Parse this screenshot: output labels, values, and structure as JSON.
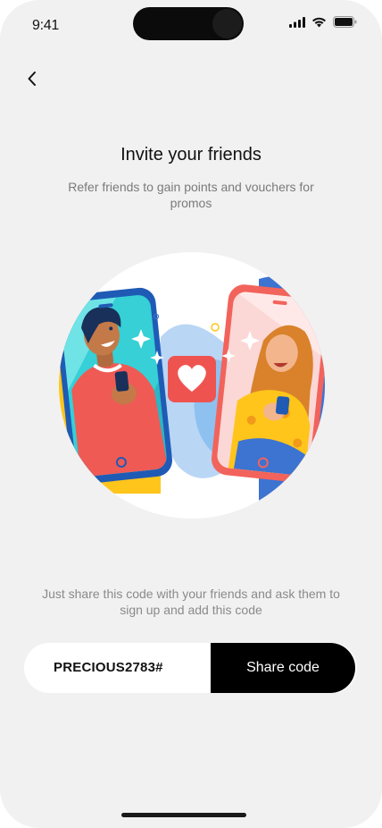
{
  "status_bar": {
    "time": "9:41"
  },
  "header": {
    "back_icon": "chevron-left-icon"
  },
  "main": {
    "title": "Invite your friends",
    "subtitle": "Refer friends to gain points and vouchers for promos",
    "illustration": "two-friends-phones-heart-illustration",
    "hint": "Just share this code with your friends and ask them to sign up and add this code"
  },
  "referral": {
    "code": "PRECIOUS2783#",
    "share_label": "Share code"
  },
  "colors": {
    "accent": "#000000",
    "background": "#f1f1f1",
    "phone_blue": "#1f5bb5",
    "phone_red": "#f2635b",
    "heart": "#ef5350"
  }
}
